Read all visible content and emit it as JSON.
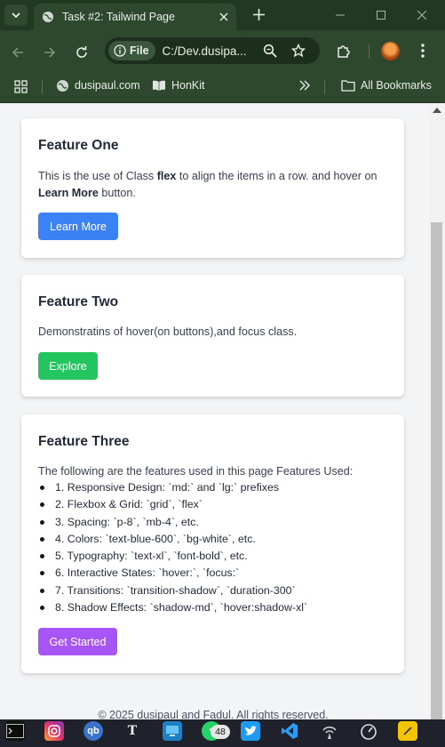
{
  "browser": {
    "tab_title": "Task #2: Tailwind Page",
    "file_chip_label": "File",
    "url": "C:/Dev.dusipa...",
    "bookmarks": [
      {
        "label": "dusipaul.com",
        "icon": "globe-icon"
      },
      {
        "label": "HonKit",
        "icon": "book-icon"
      }
    ],
    "all_bookmarks_label": "All Bookmarks"
  },
  "colors": {
    "chrome_dark": "#213821",
    "chrome": "#2e482e",
    "btn_blue": "#3b82f6",
    "btn_green": "#22c55e",
    "btn_purple": "#a855f7"
  },
  "cards": {
    "one": {
      "title": "Feature One",
      "text_before": "This is the use of Class ",
      "text_bold1": "flex",
      "text_middle": " to align the items in a row. and hover on ",
      "text_bold2": "Learn More",
      "text_after": " button.",
      "button_label": "Learn More"
    },
    "two": {
      "title": "Feature Two",
      "text": "Demonstratins of hover(on buttons),and focus class.",
      "button_label": "Explore"
    },
    "three": {
      "title": "Feature Three",
      "intro": "The following are the features used in this page Features Used:",
      "items": [
        "1. Responsive Design: `md:` and `lg:` prefixes",
        "2. Flexbox & Grid: `grid`, `flex`",
        "3. Spacing: `p-8`, `mb-4`, etc.",
        "4. Colors: `text-blue-600`, `bg-white`, etc.",
        "5. Typography: `text-xl`, `font-bold`, etc.",
        "6. Interactive States: `hover:`, `focus:`",
        "7. Transitions: `transition-shadow`, `duration-300`",
        "8. Shadow Effects: `shadow-md`, `hover:shadow-xl`"
      ],
      "button_label": "Get Started"
    }
  },
  "footer": {
    "text": "© 2025 dusipaul and Fadul. All rights reserved."
  },
  "taskbar": {
    "notification_count": "48",
    "apps": [
      "terminal-icon",
      "instagram-icon",
      "qbittorrent-icon",
      "typora-icon",
      "remote-desktop-icon",
      "whatsapp-icon",
      "twitter-icon",
      "vscode-icon",
      "network-icon",
      "speedometer-icon",
      "sticky-notes-icon"
    ]
  }
}
